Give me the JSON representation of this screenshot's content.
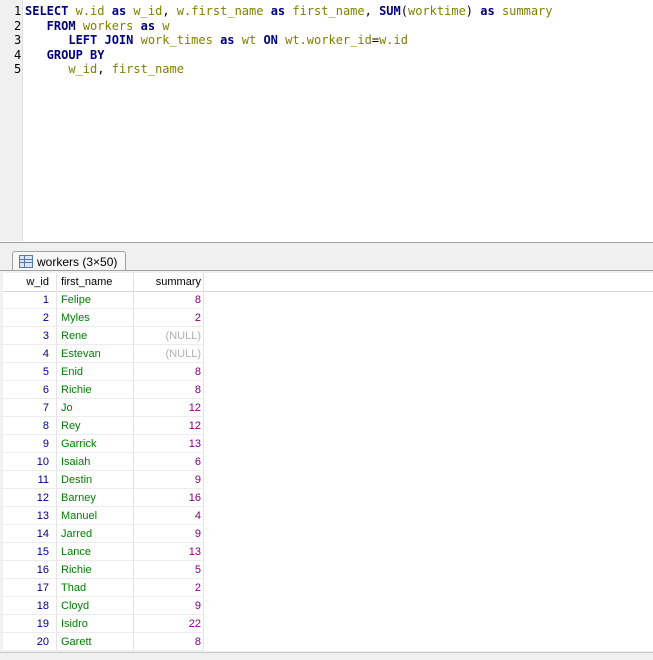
{
  "editor": {
    "line_numbers": [
      "1",
      "2",
      "3",
      "4",
      "5"
    ],
    "lines": [
      [
        {
          "t": "SELECT",
          "k": "kw"
        },
        {
          "t": " ",
          "k": "pl"
        },
        {
          "t": "w.id",
          "k": "id"
        },
        {
          "t": " as ",
          "k": "kw"
        },
        {
          "t": "w_id",
          "k": "id"
        },
        {
          "t": ", ",
          "k": "pl"
        },
        {
          "t": "w.first_name",
          "k": "id"
        },
        {
          "t": " as ",
          "k": "kw"
        },
        {
          "t": "first_name",
          "k": "id"
        },
        {
          "t": ", ",
          "k": "pl"
        },
        {
          "t": "SUM",
          "k": "kw"
        },
        {
          "t": "(",
          "k": "pl"
        },
        {
          "t": "worktime",
          "k": "id"
        },
        {
          "t": ")",
          "k": "pl"
        },
        {
          "t": " as ",
          "k": "kw"
        },
        {
          "t": "summary",
          "k": "id"
        }
      ],
      [
        {
          "t": "   FROM",
          "k": "kw"
        },
        {
          "t": " ",
          "k": "pl"
        },
        {
          "t": "workers",
          "k": "id"
        },
        {
          "t": " as ",
          "k": "kw"
        },
        {
          "t": "w",
          "k": "id"
        }
      ],
      [
        {
          "t": "      LEFT JOIN",
          "k": "kw"
        },
        {
          "t": " ",
          "k": "pl"
        },
        {
          "t": "work_times",
          "k": "id"
        },
        {
          "t": " as ",
          "k": "kw"
        },
        {
          "t": "wt",
          "k": "id"
        },
        {
          "t": " ON ",
          "k": "kw"
        },
        {
          "t": "wt.worker_id",
          "k": "id"
        },
        {
          "t": "=",
          "k": "op"
        },
        {
          "t": "w.id",
          "k": "id"
        }
      ],
      [
        {
          "t": "   GROUP BY",
          "k": "kw"
        }
      ],
      [
        {
          "t": "      ",
          "k": "pl"
        },
        {
          "t": "w_id",
          "k": "id"
        },
        {
          "t": ", ",
          "k": "pl"
        },
        {
          "t": "first_name",
          "k": "id"
        }
      ]
    ]
  },
  "result_tab": {
    "label": "workers (3×50)",
    "icon": "table-icon"
  },
  "grid": {
    "columns": [
      "w_id",
      "first_name",
      "summary"
    ],
    "rows": [
      [
        "1",
        "Felipe",
        "8"
      ],
      [
        "2",
        "Myles",
        "2"
      ],
      [
        "3",
        "Rene",
        "(NULL)"
      ],
      [
        "4",
        "Estevan",
        "(NULL)"
      ],
      [
        "5",
        "Enid",
        "8"
      ],
      [
        "6",
        "Richie",
        "8"
      ],
      [
        "7",
        "Jo",
        "12"
      ],
      [
        "8",
        "Rey",
        "12"
      ],
      [
        "9",
        "Garrick",
        "13"
      ],
      [
        "10",
        "Isaiah",
        "6"
      ],
      [
        "11",
        "Destin",
        "9"
      ],
      [
        "12",
        "Barney",
        "16"
      ],
      [
        "13",
        "Manuel",
        "4"
      ],
      [
        "14",
        "Jarred",
        "9"
      ],
      [
        "15",
        "Lance",
        "13"
      ],
      [
        "16",
        "Richie",
        "5"
      ],
      [
        "17",
        "Thad",
        "2"
      ],
      [
        "18",
        "Cloyd",
        "9"
      ],
      [
        "19",
        "Isidro",
        "22"
      ],
      [
        "20",
        "Garett",
        "8"
      ]
    ]
  },
  "colors": {
    "keyword": "#000080",
    "identifier": "#808000",
    "number": "#000080",
    "text_value": "#008000",
    "sum_value": "#800080",
    "null_value": "#b0b0b0"
  }
}
